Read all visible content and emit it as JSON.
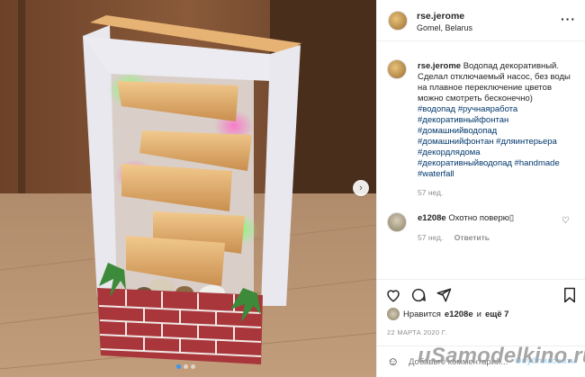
{
  "post": {
    "username": "rse.jerome",
    "location": "Gomel, Belarus",
    "more_icon": "ellipsis-icon",
    "caption_text": "Водопад декоративный. Сделал отключаемый насос, без воды на плавное переключение цветов можно смотреть бесконечно)",
    "hashtags": [
      "#водопад #ручнаяработа",
      "#декоративныйфонтан",
      "#домашнийводопад",
      "#домашнийфонтан #дляинтерьера",
      "#декордлядома",
      "#декоративныйводопад #handmade",
      "#waterfall"
    ],
    "caption_time": "57 нед.",
    "comment": {
      "username": "e1208e",
      "text": "Охотно поверю▯",
      "time": "57 нед.",
      "reply_label": "Ответить"
    },
    "likes_prefix": "Нравится",
    "likes_user": "e1208e",
    "likes_and": "и",
    "likes_more": "ещё 7",
    "date": "22 МАРТА 2020 Г.",
    "add_comment_placeholder": "Добавьте комментарий...",
    "publish_label": "Опубликовать",
    "icons": {
      "like": "heart-icon",
      "comment": "comment-icon",
      "share": "share-icon",
      "save": "bookmark-icon",
      "emoji": "smile-icon"
    }
  },
  "carousel": {
    "slides": 3,
    "active": 1
  },
  "watermark": "uSamodelkino.ru",
  "colors": {
    "link": "#00376b",
    "muted": "#8e8e8e",
    "accent": "#3897f0"
  }
}
